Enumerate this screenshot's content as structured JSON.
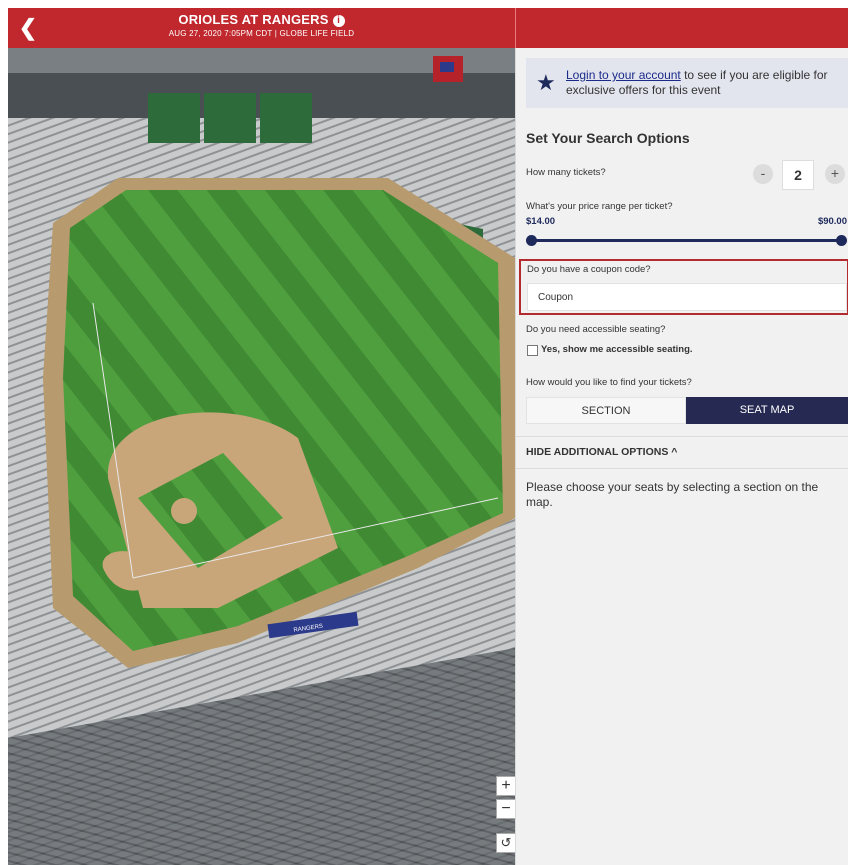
{
  "header": {
    "back_icon": "chevron-left-icon",
    "title": "ORIOLES AT RANGERS",
    "info_icon_glyph": "i",
    "subtitle": "AUG 27, 2020 7:05PM CDT | GLOBE LIFE FIELD",
    "color": "#c0282e"
  },
  "map": {
    "stadium_banner": "RANGERS",
    "zoom_in": "+",
    "zoom_out": "−",
    "reset": "↺"
  },
  "login": {
    "icon": "star-icon",
    "link": "Login to your account",
    "text_rest": " to see if you are eligible for exclusive offers for this event"
  },
  "options": {
    "heading": "Set Your Search Options",
    "tickets_question": "How many tickets?",
    "decrement": "-",
    "quantity": "2",
    "increment": "+",
    "price_question": "What's your price range per ticket?",
    "price_min": "$14.00",
    "price_max": "$90.00",
    "coupon_question": "Do you have a coupon code?",
    "coupon_placeholder": "Coupon",
    "accessible_question": "Do you need accessible seating?",
    "accessible_label": "Yes, show me accessible seating.",
    "find_question": "How would you like to find your tickets?",
    "toggle_section": "SECTION",
    "toggle_seatmap": "SEAT MAP",
    "hide_options": "HIDE ADDITIONAL OPTIONS ^",
    "help_text": "Please choose your seats by selecting a section on the map."
  },
  "colors": {
    "accent_navy": "#1f2a5c",
    "brand_red": "#c0282e",
    "field_green": "#4a9a3c",
    "dirt": "#c9a57a"
  }
}
